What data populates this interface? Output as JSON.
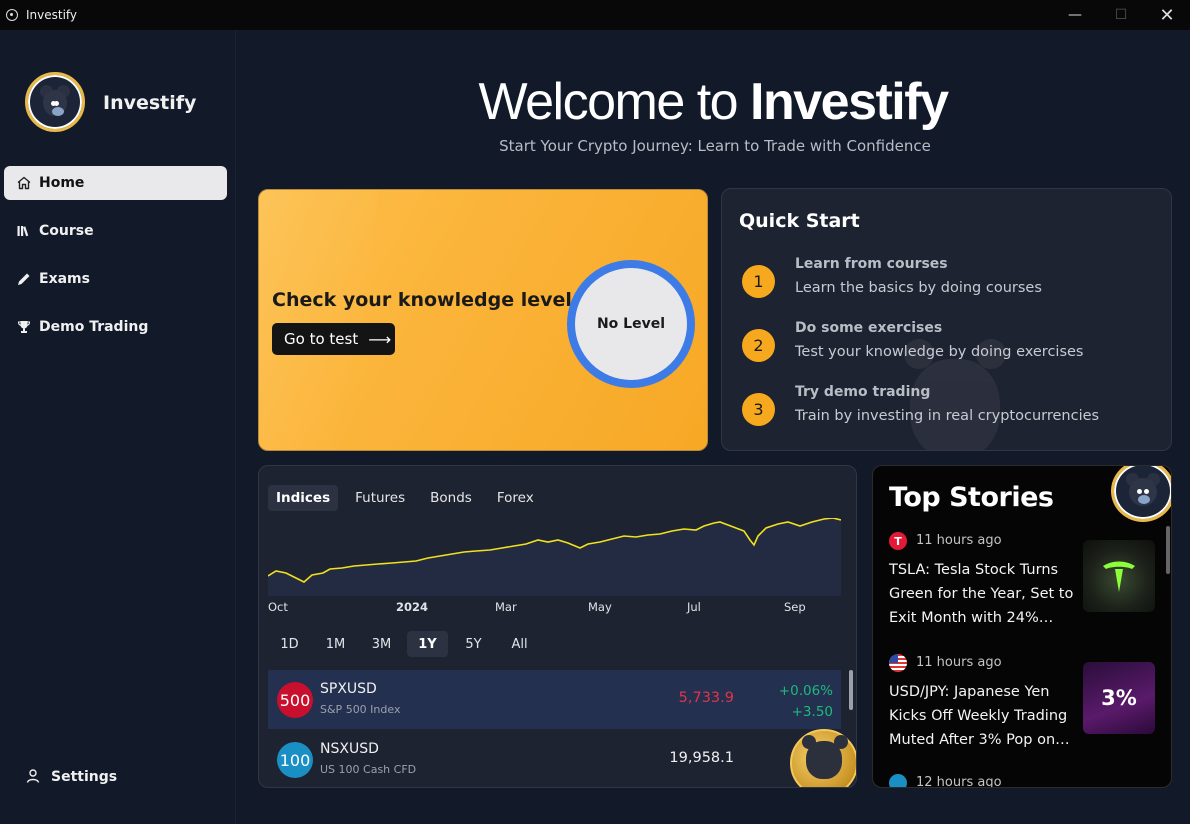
{
  "window": {
    "title": "Investify",
    "minimize": "—",
    "maximize": "☐",
    "close": "✕"
  },
  "sidebar": {
    "brand": "Investify",
    "items": [
      {
        "label": "Home",
        "icon": "home-icon",
        "active": true
      },
      {
        "label": "Course",
        "icon": "library-icon",
        "active": false
      },
      {
        "label": "Exams",
        "icon": "pencil-icon",
        "active": false
      },
      {
        "label": "Demo Trading",
        "icon": "trophy-icon",
        "active": false
      }
    ],
    "settings": "Settings"
  },
  "hero": {
    "title_prefix": "Welcome to ",
    "title_brand": "Investify",
    "subtitle": "Start Your Crypto Journey: Learn to Trade with Confidence"
  },
  "knowledge": {
    "title": "Check your knowledge level",
    "button": "Go to test",
    "level": "No Level",
    "accent": "#3d7be7"
  },
  "quick_start": {
    "title": "Quick Start",
    "steps": [
      {
        "num": "1",
        "title": "Learn from courses",
        "desc": "Learn the basics by doing courses"
      },
      {
        "num": "2",
        "title": "Do some exercises",
        "desc": "Test your knowledge by doing exercises"
      },
      {
        "num": "3",
        "title": "Try demo trading",
        "desc": "Train by investing in real cryptocurrencies"
      }
    ]
  },
  "market": {
    "tabs": [
      "Indices",
      "Futures",
      "Bonds",
      "Forex"
    ],
    "active_tab": "Indices",
    "x_labels": [
      "Oct",
      "2024",
      "Mar",
      "May",
      "Jul",
      "Sep"
    ],
    "ranges": [
      "1D",
      "1M",
      "3M",
      "1Y",
      "5Y",
      "All"
    ],
    "active_range": "1Y",
    "line_color": "#f2e11d",
    "rows": [
      {
        "badge": "500",
        "badge_color": "#c8102e",
        "symbol": "SPXUSD",
        "name": "S&P 500 Index",
        "price": "5,733.9",
        "price_color": "#e0344a",
        "change_pct": "+0.06%",
        "change_abs": "+3.50"
      },
      {
        "badge": "100",
        "badge_color": "#1a8fc4",
        "symbol": "NSXUSD",
        "name": "US 100 Cash CFD",
        "price": "19,958.1",
        "price_color": "#f0f0f0",
        "change_pct": "",
        "change_abs": ""
      }
    ]
  },
  "stories": {
    "title": "Top Stories",
    "items": [
      {
        "icon": "tesla-icon",
        "time": "11 hours ago",
        "headline": "TSLA: Tesla Stock Turns Green for the Year, Set to Exit Month with 24%…",
        "thumb_text": ""
      },
      {
        "icon": "us-flag-icon",
        "time": "11 hours ago",
        "headline": "USD/JPY: Japanese Yen Kicks Off Weekly Trading Muted After 3% Pop on…",
        "thumb_text": "3%"
      },
      {
        "icon": "globe-icon",
        "time": "12 hours ago",
        "headline": "",
        "thumb_text": ""
      }
    ]
  }
}
